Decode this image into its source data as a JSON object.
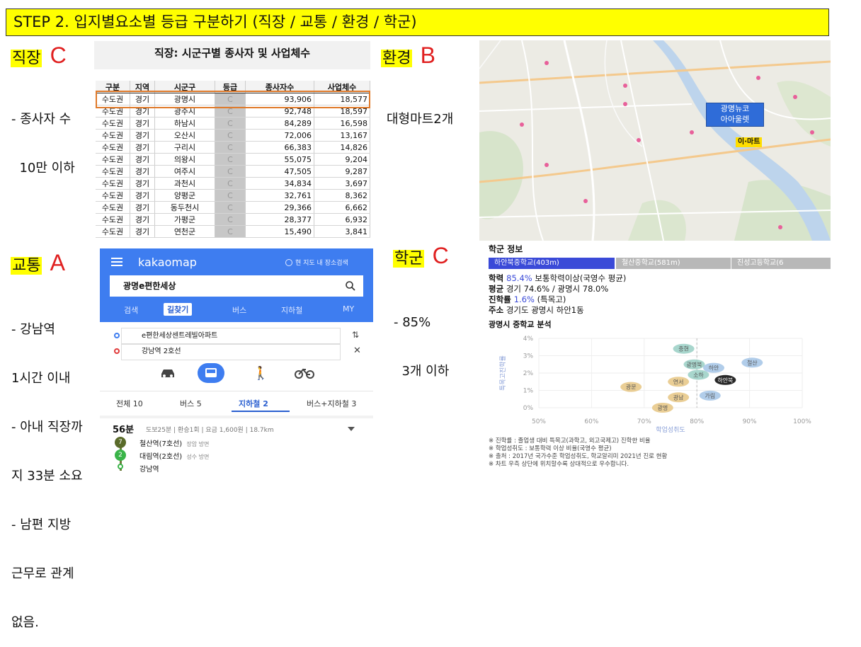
{
  "banner": "STEP 2. 입지별요소별 등급 구분하기 (직장 / 교통 / 환경 / 학군)",
  "categories": {
    "job": {
      "label": "직장",
      "grade": "C",
      "notes": [
        "- 종사자 수",
        "  10만 이하"
      ]
    },
    "env": {
      "label": "환경",
      "grade": "B",
      "notes": [
        "대형마트2개"
      ]
    },
    "traffic": {
      "label": "교통",
      "grade": "A",
      "notes": [
        "- 강남역",
        "1시간 이내",
        "- 아내 직장까",
        "지 33분 소요",
        "- 남편 지방",
        "근무로 관계",
        "없음."
      ]
    },
    "school": {
      "label": "학군",
      "grade": "C",
      "notes": [
        "- 85%",
        "  3개 이하"
      ]
    }
  },
  "job_table": {
    "title": "직장: 시군구별 종사자 및 사업체수",
    "headers": [
      "구분",
      "지역",
      "시군구",
      "등급",
      "종사자수",
      "사업체수"
    ],
    "rows": [
      [
        "수도권",
        "경기",
        "광명시",
        "C",
        "93,906",
        "18,577"
      ],
      [
        "수도권",
        "경기",
        "광주시",
        "C",
        "92,748",
        "18,597"
      ],
      [
        "수도권",
        "경기",
        "하남시",
        "C",
        "84,289",
        "16,598"
      ],
      [
        "수도권",
        "경기",
        "오산시",
        "C",
        "72,006",
        "13,167"
      ],
      [
        "수도권",
        "경기",
        "구리시",
        "C",
        "66,383",
        "14,826"
      ],
      [
        "수도권",
        "경기",
        "의왕시",
        "C",
        "55,075",
        "9,204"
      ],
      [
        "수도권",
        "경기",
        "여주시",
        "C",
        "47,505",
        "9,287"
      ],
      [
        "수도권",
        "경기",
        "과천시",
        "C",
        "34,834",
        "3,697"
      ],
      [
        "수도권",
        "경기",
        "양평군",
        "C",
        "32,761",
        "8,362"
      ],
      [
        "수도권",
        "경기",
        "동두천시",
        "C",
        "29,366",
        "6,662"
      ],
      [
        "수도권",
        "경기",
        "가평군",
        "C",
        "28,377",
        "6,932"
      ],
      [
        "수도권",
        "경기",
        "연천군",
        "C",
        "15,490",
        "3,841"
      ]
    ]
  },
  "map": {
    "poi_label_1": "광명뉴코",
    "poi_label_2": "아아울렛",
    "emart_label": "이·마트"
  },
  "kakao": {
    "logo": "kakaomap",
    "map_toggle": "현 지도 내 장소검색",
    "search_value": "광명e편한세상",
    "tabs": [
      "검색",
      "길찾기",
      "버스",
      "지하철",
      "MY"
    ],
    "active_tab": 1,
    "origin": "e편한세상센트레빌아파트",
    "destination": "강남역 2호선",
    "result_tabs": [
      "전체 10",
      "버스 5",
      "지하철 2",
      "버스+지하철 3"
    ],
    "active_result_tab": 2,
    "route": {
      "time": "56분",
      "detail": "도보25분 | 환승1회 | 요금 1,600원 | 18.7km",
      "steps": [
        {
          "line": "7",
          "station": "철산역(7호선)",
          "direction": "장암 방면",
          "color": "#5a6b2a"
        },
        {
          "line": "2",
          "station": "대림역(2호선)",
          "direction": "성수 방면",
          "color": "#3ab449"
        },
        {
          "line": "",
          "station": "강남역",
          "direction": "",
          "color": "#3ab449"
        }
      ]
    }
  },
  "school": {
    "title": "학군 정보",
    "tabs": [
      "하안북중학교(403m)",
      "철산중학교(581m)",
      "진성고등학교(6"
    ],
    "stats": [
      {
        "label": "학력",
        "highlight": "85.4%",
        "rest": " 보통학력이상(국영수 평균)"
      },
      {
        "label": "평균",
        "highlight": "",
        "rest": " 경기 74.6% / 광명시 78.0%"
      },
      {
        "label": "진학률",
        "highlight": "1.6%",
        "rest": " (특목고)"
      },
      {
        "label": "주소",
        "highlight": "",
        "rest": " 경기도 광명시 하안1동"
      }
    ],
    "chart_title": "광명시 중학교 분석",
    "footnotes": [
      "※ 진학률 : 졸업생 대비 특목고(과학고, 외고국제고) 진학한 비율",
      "※ 학업성취도 : 보통학력 이상 비율(국영수 평균)",
      "※ 출처 : 2017년 국가수준 학업성취도, 학교알리미 2021년 진로 현황",
      "※ 차트 우측 상단에 위치할수록 상대적으로 우수합니다."
    ]
  },
  "chart_data": {
    "type": "scatter",
    "title": "광명시 중학교 분석",
    "xlabel": "학업성취도",
    "ylabel": "특목고진학률",
    "x_ticks": [
      "50%",
      "60%",
      "70%",
      "80%",
      "90%",
      "100%"
    ],
    "y_ticks": [
      "0%",
      "1%",
      "2%",
      "3%",
      "4%"
    ],
    "xlim": [
      50,
      100
    ],
    "ylim": [
      0,
      4
    ],
    "points": [
      {
        "name": "광문",
        "x": 67.5,
        "y": 1.2,
        "color": "#e8c98a"
      },
      {
        "name": "연서",
        "x": 76.5,
        "y": 1.5,
        "color": "#e8c98a"
      },
      {
        "name": "광남",
        "x": 76.5,
        "y": 0.6,
        "color": "#e8c98a"
      },
      {
        "name": "광명",
        "x": 73.5,
        "y": 0.0,
        "color": "#e8c98a"
      },
      {
        "name": "충현",
        "x": 77.5,
        "y": 3.4,
        "color": "#9fd2c8"
      },
      {
        "name": "광명북",
        "x": 79.5,
        "y": 2.5,
        "color": "#9fd2c8"
      },
      {
        "name": "소하",
        "x": 80.3,
        "y": 1.9,
        "color": "#9fd2c8"
      },
      {
        "name": "가림",
        "x": 82.5,
        "y": 0.7,
        "color": "#a8c8e8"
      },
      {
        "name": "하안",
        "x": 83.2,
        "y": 2.3,
        "color": "#a8c8e8"
      },
      {
        "name": "철산",
        "x": 90.5,
        "y": 2.6,
        "color": "#a8c8e8"
      },
      {
        "name": "하안북",
        "x": 85.4,
        "y": 1.6,
        "color": "#111111"
      }
    ]
  }
}
